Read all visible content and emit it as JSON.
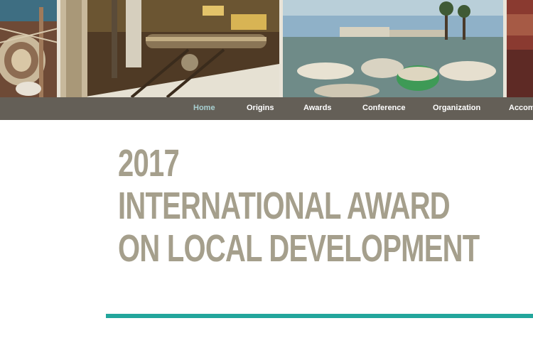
{
  "nav": {
    "items": [
      {
        "label": "Home",
        "active": true
      },
      {
        "label": "Origins",
        "active": false
      },
      {
        "label": "Awards",
        "active": false
      },
      {
        "label": "Conference",
        "active": false
      },
      {
        "label": "Organization",
        "active": false
      },
      {
        "label": "Accomo",
        "active": false
      }
    ]
  },
  "headline": {
    "year": "2017",
    "line1": "INTERNATIONAL AWARD",
    "line2": "ON LOCAL DEVELOPMENT"
  },
  "colors": {
    "nav_bg": "#645f57",
    "nav_active": "#a8d0d2",
    "headline": "#a59f8c",
    "accent_rule": "#22a69c"
  }
}
